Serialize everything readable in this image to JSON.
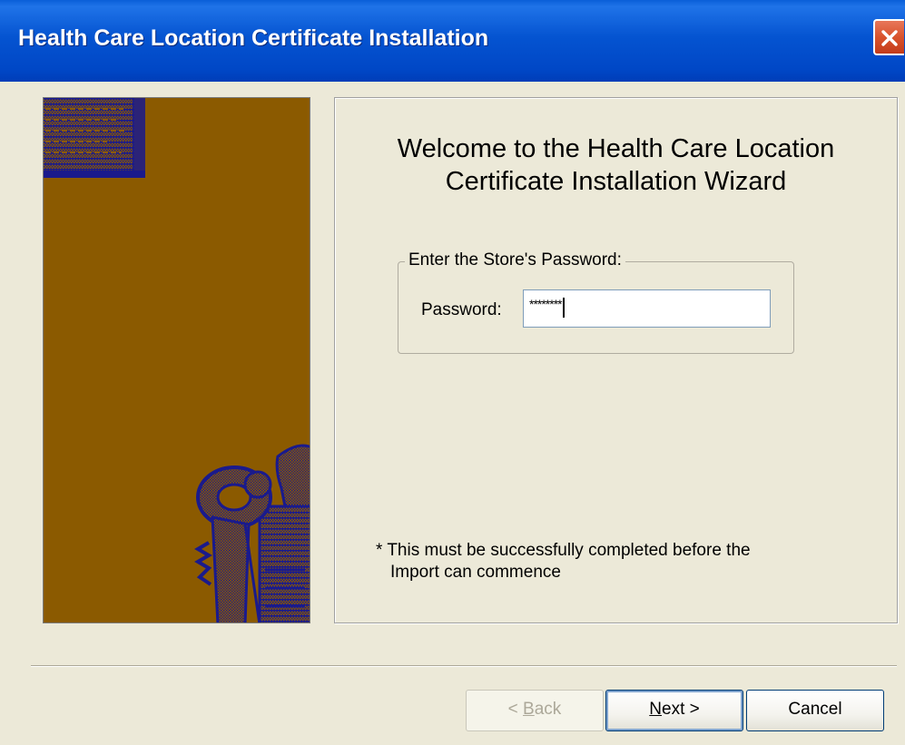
{
  "window": {
    "title": "Health Care Location Certificate Installation"
  },
  "welcome": {
    "line1": "Welcome to the Health Care Location",
    "line2": "Certificate Installation Wizard"
  },
  "password_group": {
    "legend": "Enter the Store's Password:",
    "label": "Password:",
    "masked_value": "********"
  },
  "note": {
    "line1": "* This must be successfully completed before the",
    "line2": "Import can commence"
  },
  "buttons": {
    "back_prefix": "< ",
    "back_mnemonic": "B",
    "back_rest": "ack",
    "next_mnemonic": "N",
    "next_rest": "ext >",
    "cancel": "Cancel"
  },
  "colors": {
    "titlebar": "#0554D1",
    "side_panel": "#8B5A00",
    "artwork": "#1A1A8C",
    "dialog_bg": "#ECE9D8"
  },
  "icons": {
    "close": "close-icon",
    "keys": "keys-illustration",
    "document": "document-illustration"
  }
}
